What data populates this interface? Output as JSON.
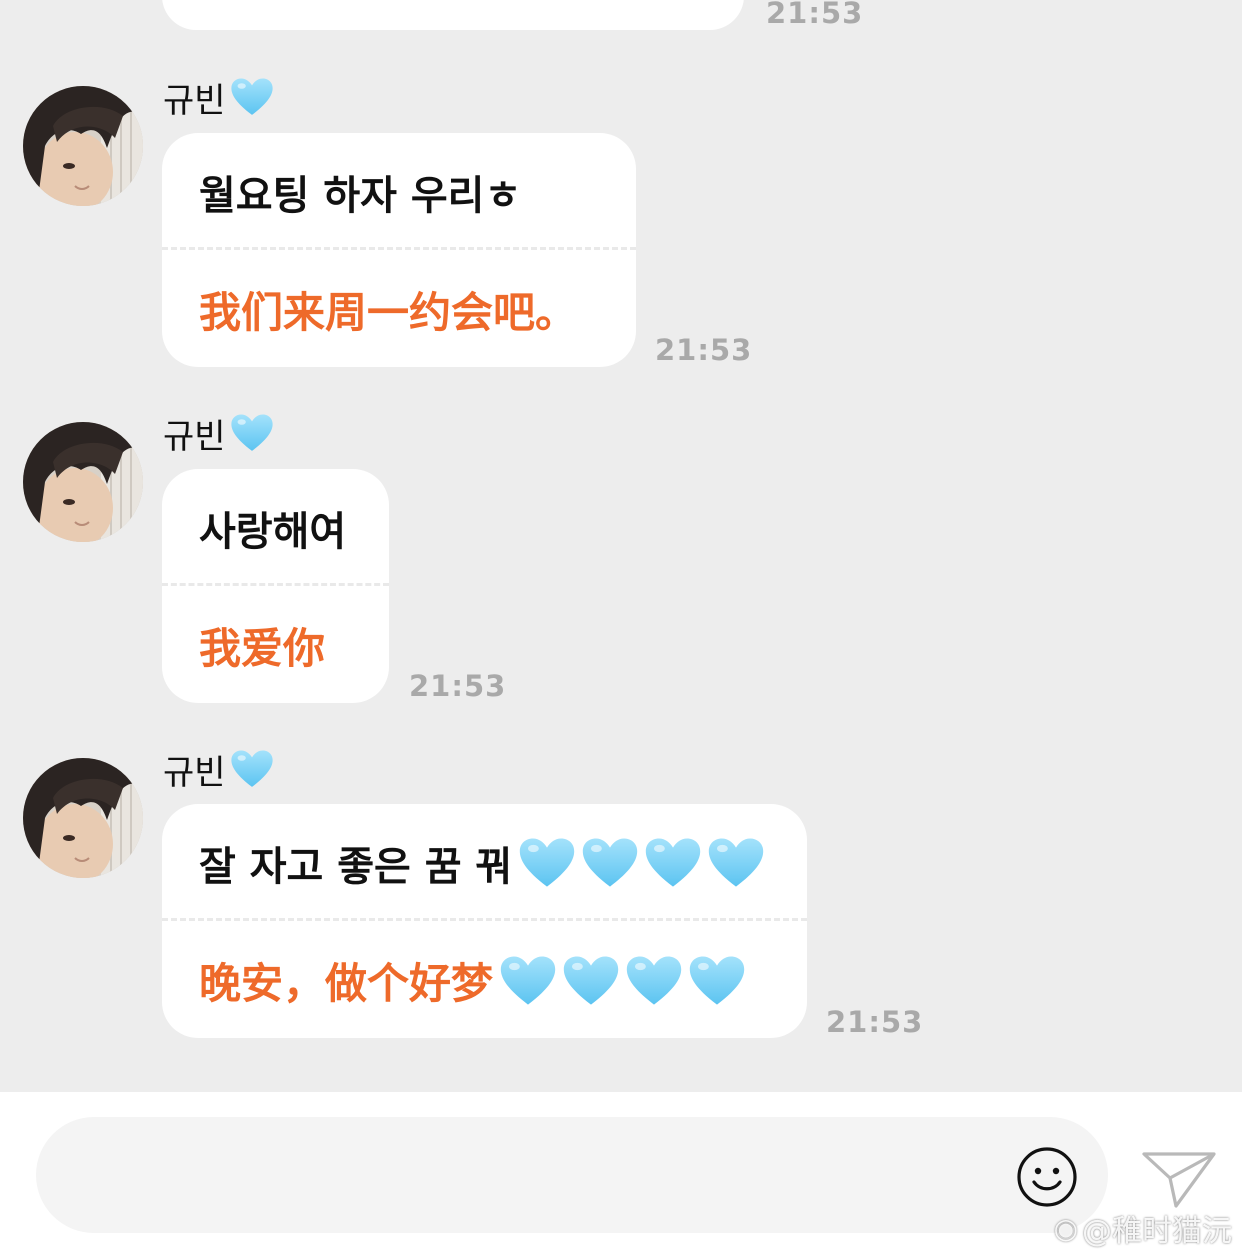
{
  "previous": {
    "time": "21:53"
  },
  "messages": [
    {
      "sender": "규빈",
      "ko": "월요팅 하자 우리ㅎ",
      "zh": "我们来周一约会吧。",
      "time": "21:53",
      "ko_hearts": 0,
      "zh_hearts": 0
    },
    {
      "sender": "규빈",
      "ko": "사랑해여",
      "zh": "我爱你",
      "time": "21:53",
      "ko_hearts": 0,
      "zh_hearts": 0
    },
    {
      "sender": "규빈",
      "ko": "잘 자고 좋은 꿈 꿔",
      "zh": "晚安，做个好梦",
      "time": "21:53",
      "ko_hearts": 4,
      "zh_hearts": 4
    }
  ],
  "icons": {
    "sender_badge": "light-blue-heart-icon",
    "emoji": "smiley-face-icon",
    "send": "paper-plane-icon"
  },
  "colors": {
    "background": "#ededed",
    "translation_text": "#ee6a2a",
    "heart": "#7fd3f7"
  },
  "composer": {
    "value": ""
  },
  "watermark": {
    "text": "@稚时猫沅"
  }
}
